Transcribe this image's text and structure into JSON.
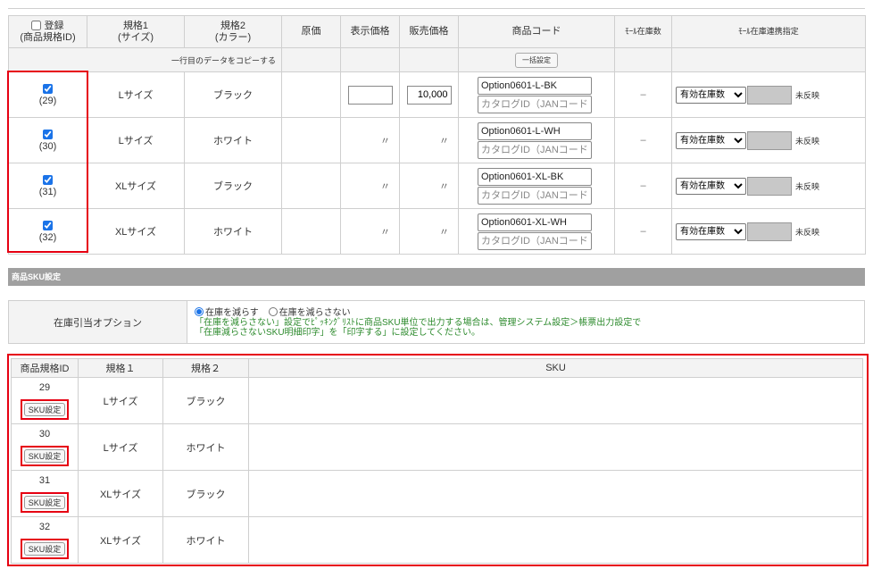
{
  "variant_table": {
    "headers": {
      "register": "登録",
      "register_sub": "(商品規格ID)",
      "spec1": "規格1",
      "spec1_sub": "(サイズ)",
      "spec2": "規格2",
      "spec2_sub": "(カラー)",
      "cost": "原価",
      "display_price": "表示価格",
      "sale_price": "販売価格",
      "product_code": "商品コード",
      "mall_stock": "ﾓｰﾙ在庫数",
      "mall_stock_link": "ﾓｰﾙ在庫連携指定"
    },
    "copy_row_text": "一行目のデータをコピーする",
    "bulk_button": "一括設定",
    "rows": [
      {
        "id": "(29)",
        "checked": true,
        "spec1": "Lサイズ",
        "spec2": "ブラック",
        "display_price": "",
        "sale_price": "10,000",
        "code": "Option0601-L-BK",
        "stock": "–",
        "stock_select": "有効在庫数",
        "status": "未反映"
      },
      {
        "id": "(30)",
        "checked": true,
        "spec1": "Lサイズ",
        "spec2": "ホワイト",
        "display_price": "〃",
        "sale_price": "〃",
        "code": "Option0601-L-WH",
        "stock": "–",
        "stock_select": "有効在庫数",
        "status": "未反映"
      },
      {
        "id": "(31)",
        "checked": true,
        "spec1": "XLサイズ",
        "spec2": "ブラック",
        "display_price": "〃",
        "sale_price": "〃",
        "code": "Option0601-XL-BK",
        "stock": "–",
        "stock_select": "有効在庫数",
        "status": "未反映"
      },
      {
        "id": "(32)",
        "checked": true,
        "spec1": "XLサイズ",
        "spec2": "ホワイト",
        "display_price": "〃",
        "sale_price": "〃",
        "code": "Option0601-XL-WH",
        "stock": "–",
        "stock_select": "有効在庫数",
        "status": "未反映"
      }
    ],
    "catalog_placeholder": "カタログID（JANコード）"
  },
  "sku_section": {
    "title": "商品SKU設定",
    "option_label": "在庫引当オプション",
    "radio_reduce": "在庫を減らす",
    "radio_not_reduce": "在庫を減らさない",
    "selected": "reduce",
    "note_line1": "「在庫を減らさない」設定でﾋﾟｯｷﾝｸﾞﾘｽﾄに商品SKU単位で出力する場合は、管理システム設定＞帳票出力設定で",
    "note_line2": "「在庫減らさないSKU明細印字」を「印字する」に設定してください。"
  },
  "sku_table": {
    "headers": {
      "id": "商品規格ID",
      "spec1": "規格１",
      "spec2": "規格２",
      "sku": "SKU"
    },
    "button_label": "SKU設定",
    "rows": [
      {
        "id": "29",
        "spec1": "Lサイズ",
        "spec2": "ブラック"
      },
      {
        "id": "30",
        "spec1": "Lサイズ",
        "spec2": "ホワイト"
      },
      {
        "id": "31",
        "spec1": "XLサイズ",
        "spec2": "ブラック"
      },
      {
        "id": "32",
        "spec1": "XLサイズ",
        "spec2": "ホワイト"
      }
    ]
  },
  "colors": {
    "highlight": "#e60012",
    "note": "#2e8b2e",
    "section_bar": "#a0a0a0",
    "header_bg": "#f3f3f3"
  }
}
